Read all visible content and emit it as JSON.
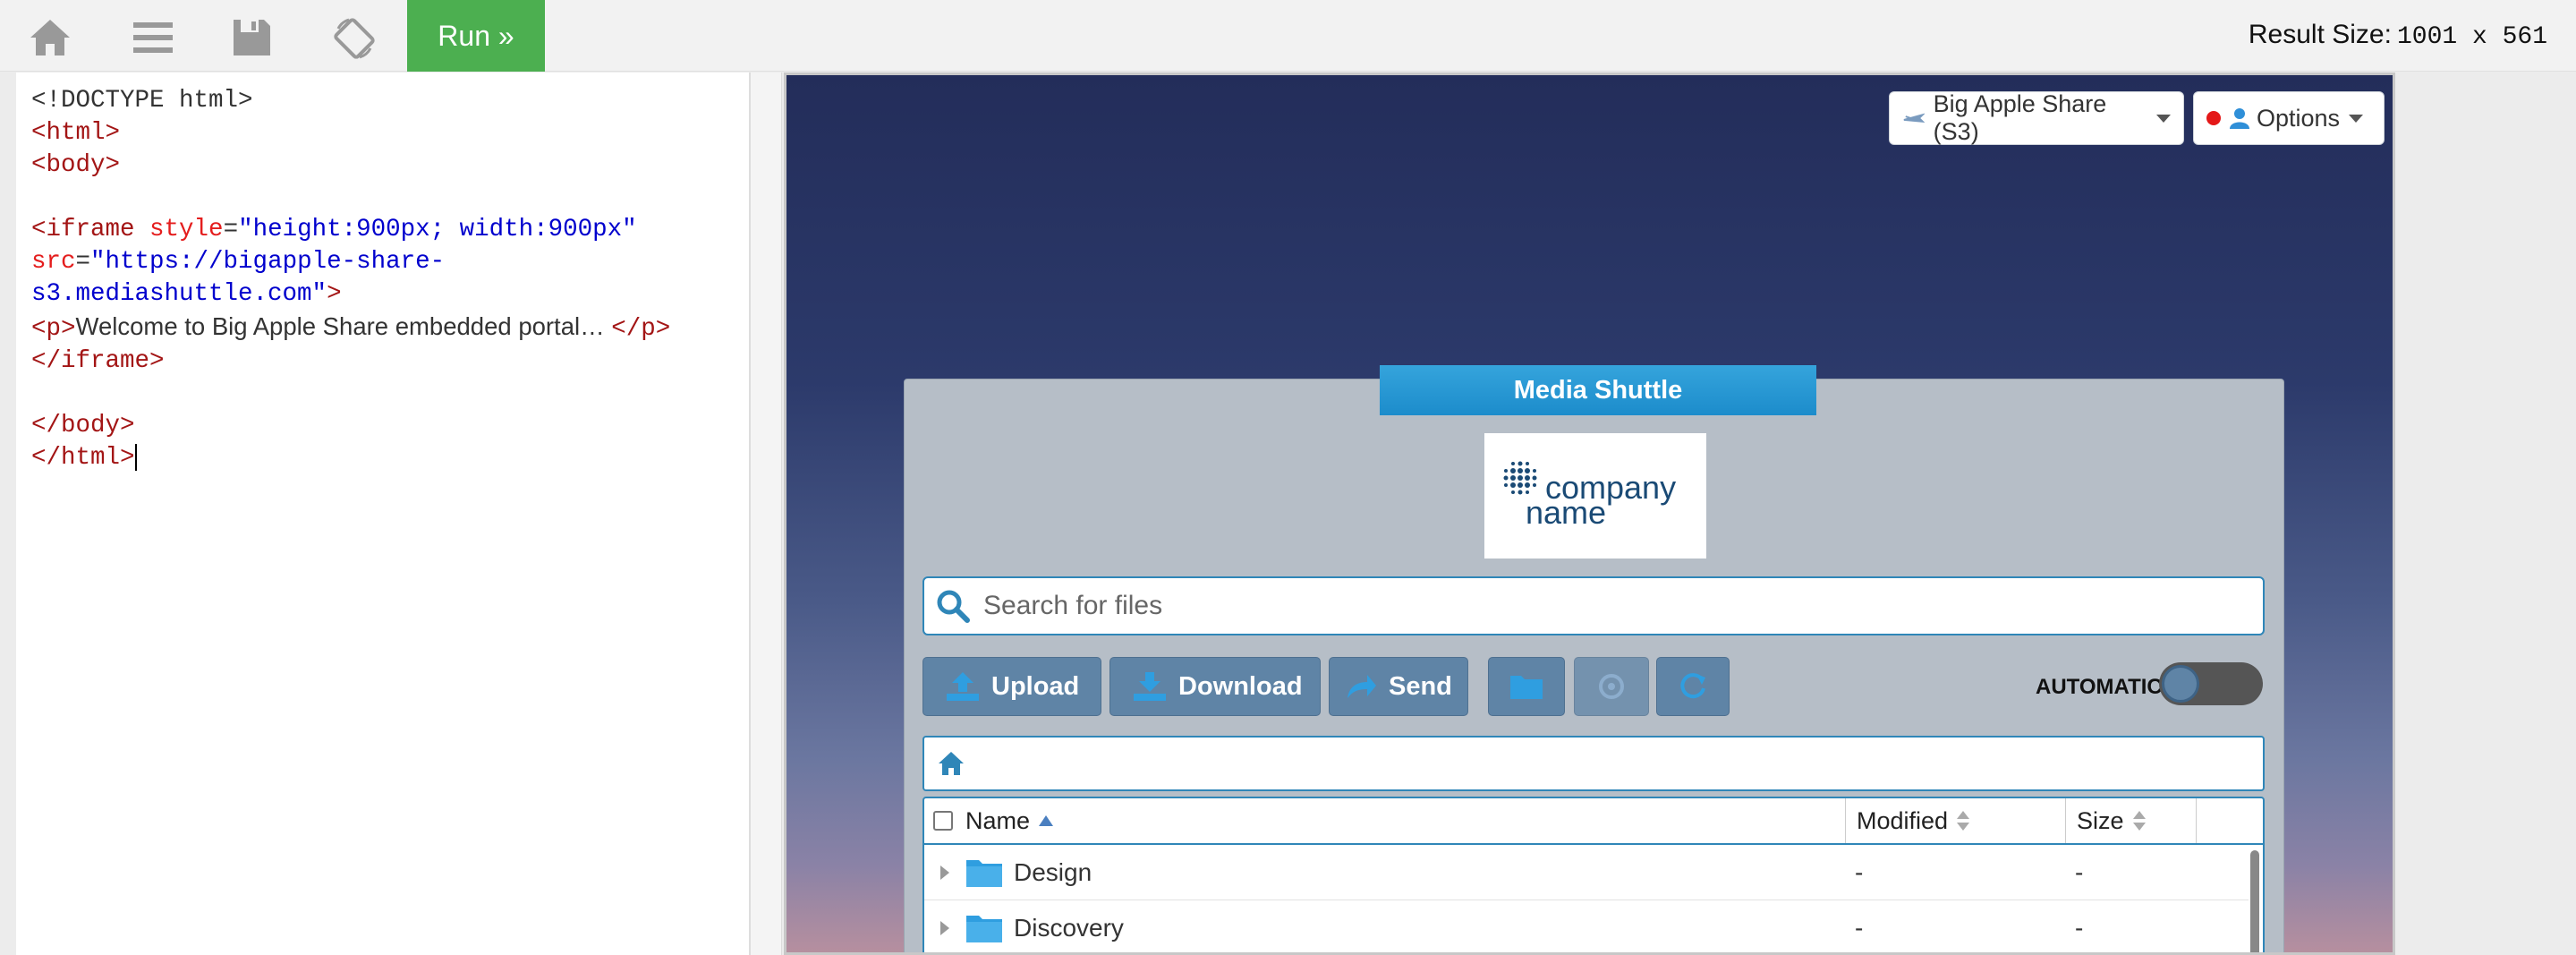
{
  "toolbar": {
    "icons": [
      "home-icon",
      "menu-icon",
      "save-icon",
      "rotate-icon"
    ],
    "run_label": "Run »",
    "result_size_label": "Result Size:",
    "result_size_value": "1001 x 561"
  },
  "editor": {
    "lines": {
      "l1": "<!DOCTYPE html>",
      "l2_tag": "<html>",
      "l3_tag": "<body>",
      "l5_open": "<iframe",
      "l5_attr": "style",
      "l5_val": "\"height:900px; width:900px\"",
      "l6_attr": "src",
      "l6_val": "\"https://bigapple-share-",
      "l7_val": "s3.mediashuttle.com\"",
      "l7_close": ">",
      "l8_open": "<p>",
      "l8_text": "Welcome to Big Apple Share embedded portal… ",
      "l8_close": "</p>",
      "l9_tag": "</iframe>",
      "l11_tag": "</body>",
      "l12_tag": "</html>"
    }
  },
  "portal": {
    "share_dropdown": "Big Apple Share (S3)",
    "options_dropdown": "Options",
    "app_title": "Media Shuttle",
    "logo_text_1": "company",
    "logo_text_2": "name",
    "search_placeholder": "Search for files",
    "buttons": {
      "upload": "Upload",
      "download": "Download",
      "send": "Send"
    },
    "automatic_label": "AUTOMATIC",
    "automatic_on": false,
    "table": {
      "headers": {
        "name": "Name",
        "modified": "Modified",
        "size": "Size"
      },
      "rows": [
        {
          "name": "Design",
          "modified": "-",
          "size": "-"
        },
        {
          "name": "Discovery",
          "modified": "-",
          "size": "-"
        }
      ]
    }
  },
  "colors": {
    "run_green": "#4caf50",
    "accent_blue": "#2f86b8",
    "folder_blue": "#2f9ee0",
    "button_steel": "#5f84a6"
  }
}
